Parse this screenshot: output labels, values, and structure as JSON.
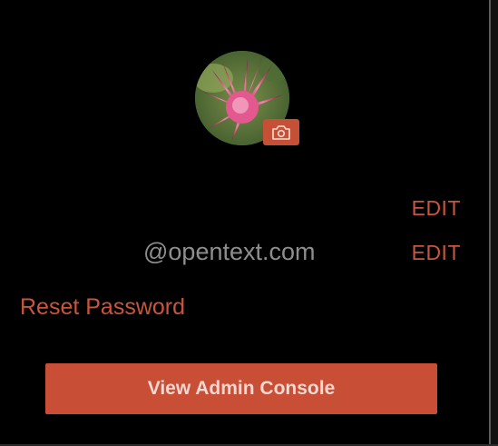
{
  "profile": {
    "avatar_icon": "profile-photo",
    "camera_icon": "camera-icon"
  },
  "rows": {
    "name_edit_label": "EDIT",
    "email": "@opentext.com",
    "email_edit_label": "EDIT"
  },
  "reset_password_label": "Reset Password",
  "admin_console_label": "View Admin Console",
  "colors": {
    "background": "#000000",
    "accent": "#c8553c",
    "muted_text": "#8e8e8e",
    "button_text": "#f1d8d2"
  }
}
